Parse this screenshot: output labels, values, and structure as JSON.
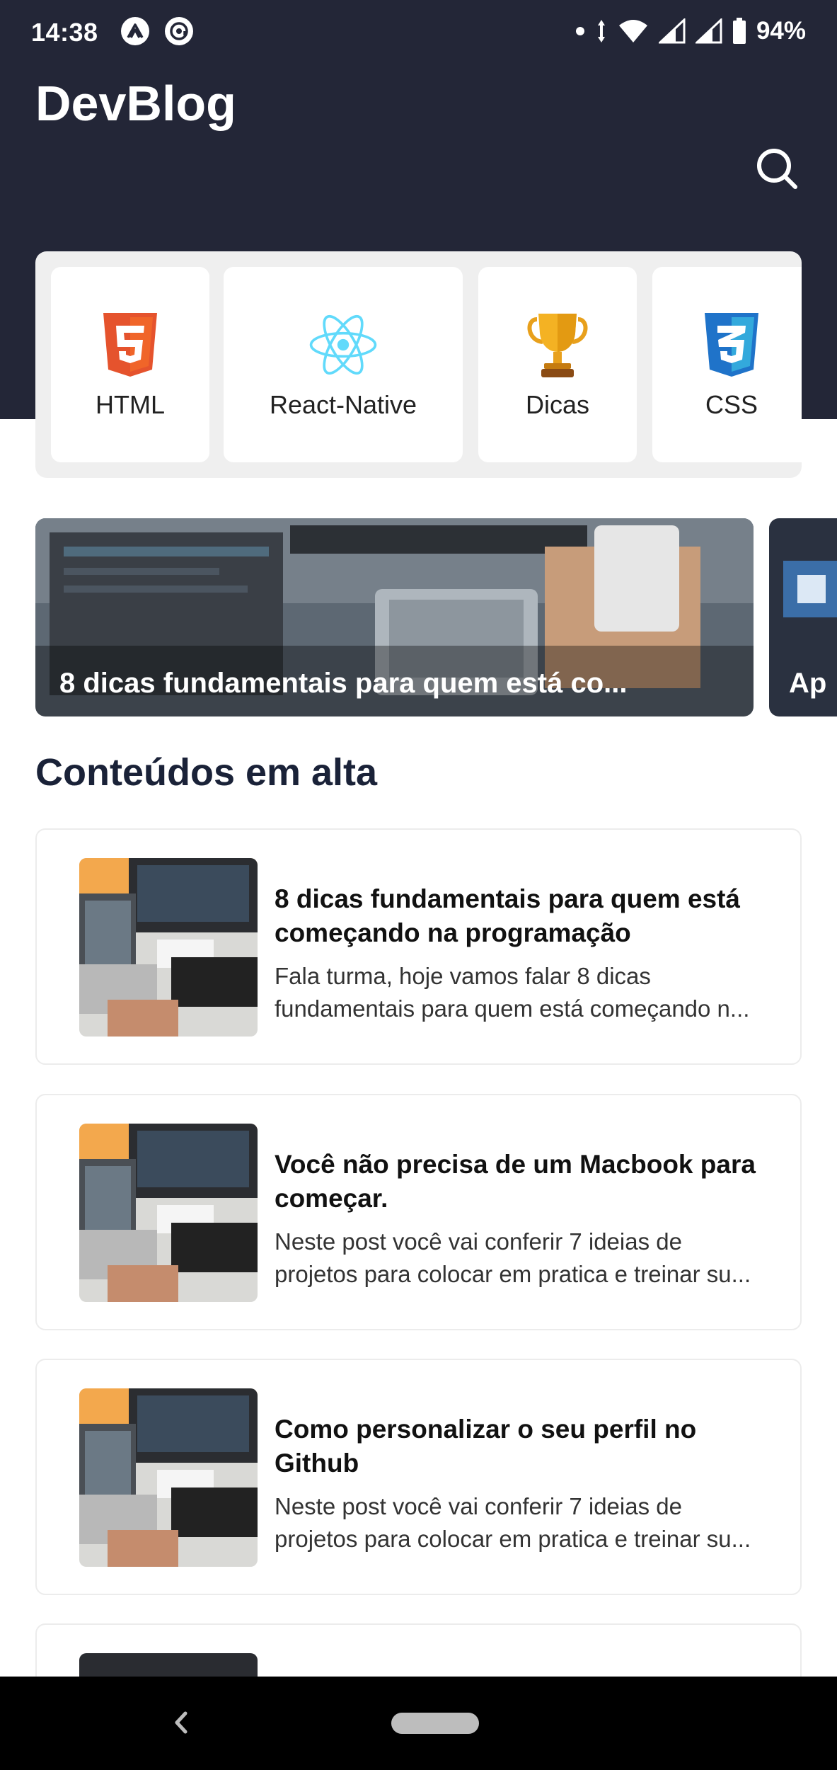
{
  "status": {
    "time": "14:38",
    "battery": "94%"
  },
  "header": {
    "title": "DevBlog"
  },
  "categories": [
    {
      "label": "HTML",
      "icon": "html5-icon",
      "color": "#e5532d"
    },
    {
      "label": "React-Native",
      "icon": "react-icon",
      "color": "#61dafb"
    },
    {
      "label": "Dicas",
      "icon": "trophy-icon",
      "color": "#e8a01c"
    },
    {
      "label": "CSS",
      "icon": "css3-icon",
      "color": "#1f73c9"
    }
  ],
  "featured": [
    {
      "title": "8 dicas fundamentais para quem está co..."
    },
    {
      "title": "Ap"
    }
  ],
  "section_title": "Conteúdos em alta",
  "posts": [
    {
      "title": "8 dicas fundamentais para quem está começando na programação",
      "desc_line1": "Fala turma, hoje vamos falar 8 dicas",
      "desc_line2": "fundamentais para quem está começando n..."
    },
    {
      "title": "Você não precisa de um Macbook para começar.",
      "desc_line1": "Neste post você vai conferir 7 ideias de",
      "desc_line2": "projetos para colocar em pratica e treinar su..."
    },
    {
      "title": "Como personalizar o seu perfil no Github",
      "desc_line1": "Neste post você vai conferir 7 ideias de",
      "desc_line2": "projetos para colocar em pratica e treinar su..."
    }
  ],
  "colors": {
    "header_bg": "#232637",
    "section_title": "#1a2238",
    "panel_bg": "#efefef"
  }
}
